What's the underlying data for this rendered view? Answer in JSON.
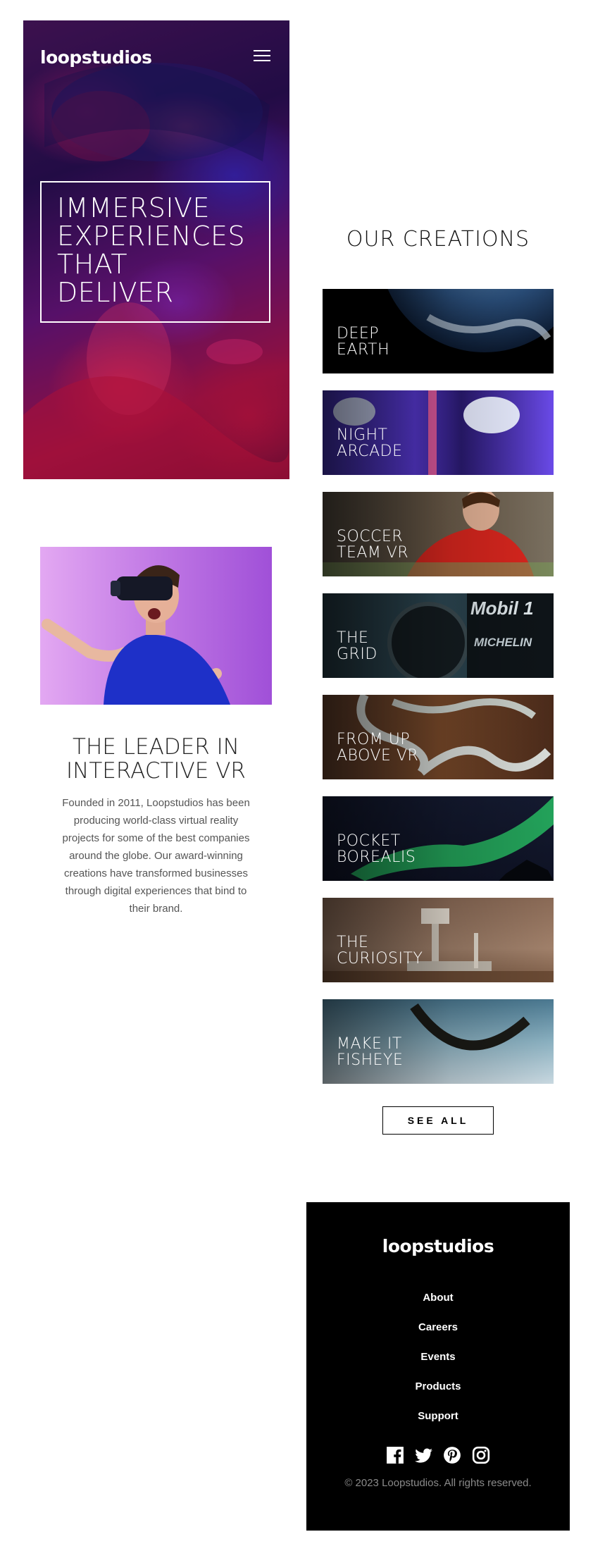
{
  "header": {
    "logo": "loopstudios",
    "menu_icon": "hamburger-icon"
  },
  "hero": {
    "headline_lines": [
      "IMMERSIVE",
      "EXPERIENCES",
      "THAT",
      "DELIVER"
    ]
  },
  "intro": {
    "title_lines": [
      "THE LEADER IN",
      "INTERACTIVE VR"
    ],
    "body": "Founded in 2011, Loopstudios has been producing world-class virtual reality projects for some of the best companies around the globe. Our award-winning creations have transformed businesses through digital experiences that bind to their brand."
  },
  "creations": {
    "title": "OUR CREATIONS",
    "items": [
      {
        "lines": [
          "DEEP",
          "EARTH"
        ]
      },
      {
        "lines": [
          "NIGHT",
          "ARCADE"
        ]
      },
      {
        "lines": [
          "SOCCER",
          "TEAM VR"
        ]
      },
      {
        "lines": [
          "THE",
          "GRID"
        ]
      },
      {
        "lines": [
          "FROM UP",
          "ABOVE VR"
        ]
      },
      {
        "lines": [
          "POCKET",
          "BOREALIS"
        ]
      },
      {
        "lines": [
          "THE",
          "CURIOSITY"
        ]
      },
      {
        "lines": [
          "MAKE IT",
          "FISHEYE"
        ]
      }
    ],
    "see_all": "SEE ALL"
  },
  "footer": {
    "logo": "loopstudios",
    "nav": [
      "About",
      "Careers",
      "Events",
      "Products",
      "Support"
    ],
    "socials": [
      "facebook-icon",
      "twitter-icon",
      "pinterest-icon",
      "instagram-icon"
    ],
    "copyright": "© 2023 Loopstudios. All rights reserved."
  },
  "colors": {
    "background": "#ffffff",
    "footer_background": "#000000",
    "text_dark": "#222222",
    "text_muted": "#555555",
    "copyright": "#8a8a8a"
  }
}
